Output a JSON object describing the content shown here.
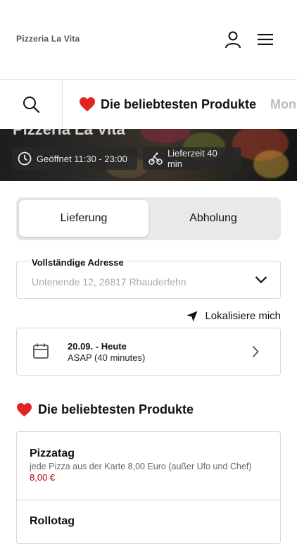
{
  "header": {
    "brand": "Pizzeria La Vita",
    "user_icon": "user-icon",
    "menu_icon": "hamburger-menu-icon"
  },
  "category_bar": {
    "search_icon": "search-icon",
    "items": [
      {
        "label": "Die beliebtesten Produkte",
        "icon": "heart-icon",
        "active": true
      },
      {
        "label": "Mon",
        "active": false
      }
    ]
  },
  "hero": {
    "title": "Pizzeria La Vita",
    "opening_hours": "Geöffnet 11:30 - 23:00",
    "delivery_time": "Lieferzeit 40 min"
  },
  "order_type": {
    "options": [
      "Lieferung",
      "Abholung"
    ],
    "selected": "Lieferung"
  },
  "address": {
    "label": "Vollständige Adresse",
    "value": "Untenende 12, 26817 Rhauderfehn"
  },
  "locate_label": "Lokalisiere mich",
  "delivery_date": {
    "date": "20.09. - Heute",
    "time": "ASAP (40 minutes)"
  },
  "section": {
    "title": "Die beliebtesten Produkte"
  },
  "products": [
    {
      "name": "Pizzatag",
      "description": "jede Pizza aus der Karte 8,00 Euro (außer Ufo und Chef)",
      "price": "8,00 €"
    },
    {
      "name": "Rollotag"
    }
  ],
  "colors": {
    "heart": "#e02424",
    "price": "#b40000",
    "toggle_bg": "#e9e9e9"
  }
}
